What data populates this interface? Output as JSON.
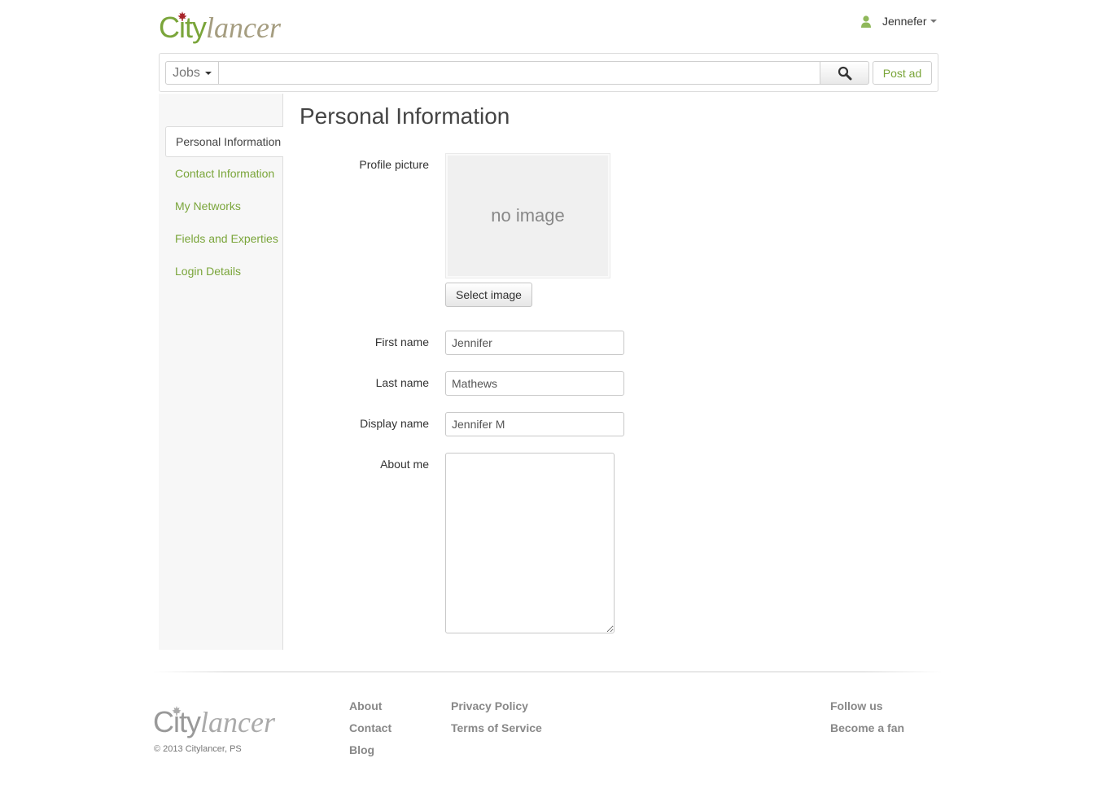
{
  "brand": {
    "logo_city": "City",
    "logo_lancer": "lancer"
  },
  "header": {
    "user_name": "Jennefer"
  },
  "search": {
    "category_label": "Jobs",
    "query_value": "",
    "post_ad_label": "Post ad"
  },
  "sidebar": {
    "items": [
      {
        "label": "Personal Information"
      },
      {
        "label": "Contact Information"
      },
      {
        "label": "My Networks"
      },
      {
        "label": "Fields and Experties"
      },
      {
        "label": "Login Details"
      }
    ]
  },
  "form": {
    "title": "Personal Information",
    "profile_picture_label": "Profile picture",
    "no_image_text": "no image",
    "select_image_label": "Select image",
    "first_name_label": "First name",
    "first_name_value": "Jennifer",
    "last_name_label": "Last name",
    "last_name_value": "Mathews",
    "display_name_label": "Display name",
    "display_name_value": "Jennifer M",
    "about_me_label": "About me",
    "about_me_value": ""
  },
  "footer": {
    "logo_city": "City",
    "logo_lancer": "lancer",
    "copyright": "© 2013 Citylancer, PS",
    "col1": [
      "About",
      "Contact",
      "Blog"
    ],
    "col2": [
      "Privacy Policy",
      "Terms of Service"
    ],
    "col3": [
      "Follow us",
      "Become a fan"
    ]
  },
  "colors": {
    "brand_green": "#7aa53a",
    "logo_tan": "#a59d80",
    "leaf_red": "#a8252a"
  }
}
